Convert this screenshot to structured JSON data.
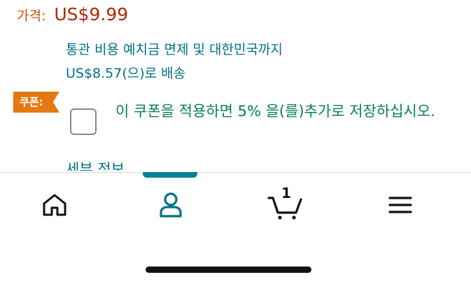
{
  "price": {
    "label": "가격:",
    "value": "US$9.99"
  },
  "import_fee": {
    "line1": "통관 비용 예치금 면제 및 대한민국까지",
    "line2": "US$8.57(으)로 배송"
  },
  "coupon": {
    "badge": "쿠폰:",
    "text": "이 쿠폰을 적용하면 5% 을(를)추가로 저장하십시오.",
    "checked": false
  },
  "details_link": "세부 정보",
  "tabbar": {
    "active_tab": "profile",
    "items": [
      {
        "id": "home",
        "icon": "home-icon"
      },
      {
        "id": "profile",
        "icon": "user-icon"
      },
      {
        "id": "cart",
        "icon": "cart-icon",
        "count": "1"
      },
      {
        "id": "menu",
        "icon": "menu-icon"
      }
    ]
  },
  "colors": {
    "price_label": "#c45500",
    "price": "#b12704",
    "link": "#007185",
    "coupon_badge": "#e47911",
    "coupon_text": "#067d62",
    "active_tab": "#008296"
  }
}
